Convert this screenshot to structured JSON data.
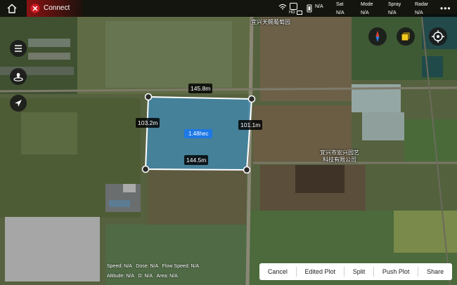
{
  "topbar": {
    "connect_label": "Connect",
    "hd_label": "HD",
    "stats": [
      {
        "label": "",
        "value": "N/A",
        "icon": "remote-controller-icon"
      },
      {
        "label": "Sat",
        "value": "N/A"
      },
      {
        "label": "Mode",
        "value": "N/A"
      },
      {
        "label": "Spray",
        "value": "N/A"
      },
      {
        "label": "Radar",
        "value": "N/A"
      }
    ],
    "more_label": "•••"
  },
  "map": {
    "place_top": "宜兴天赐葡萄园",
    "place_right_line1": "宜兴市宏兴园艺",
    "place_right_line2": "科技有限公司"
  },
  "plot": {
    "top_edge": "145.8m",
    "left_edge": "103.2m",
    "right_edge": "101.1m",
    "bottom_edge": "144.5m",
    "area": "1.48hec"
  },
  "telemetry": {
    "speed_label": "Speed:",
    "speed_value": "N/A",
    "dose_label": "Dose:",
    "dose_value": "N/A",
    "flow_label": "Flow Speed:",
    "flow_value": "N/A",
    "altitude_label": "Altitude:",
    "altitude_value": "N/A",
    "d_label": "D:",
    "d_value": "N/A",
    "area_label": "Area:",
    "area_value": "N/A"
  },
  "actions": {
    "cancel": "Cancel",
    "edited_plot": "Edited Plot",
    "split": "Split",
    "push_plot": "Push Plot",
    "share": "Share"
  },
  "colors": {
    "topbar_bg": "#000000",
    "connect_red": "#c0141e",
    "plot_fill": "#3e8dbd",
    "area_label_bg": "#1e78e6",
    "accent_yellow": "#f2c81c"
  }
}
